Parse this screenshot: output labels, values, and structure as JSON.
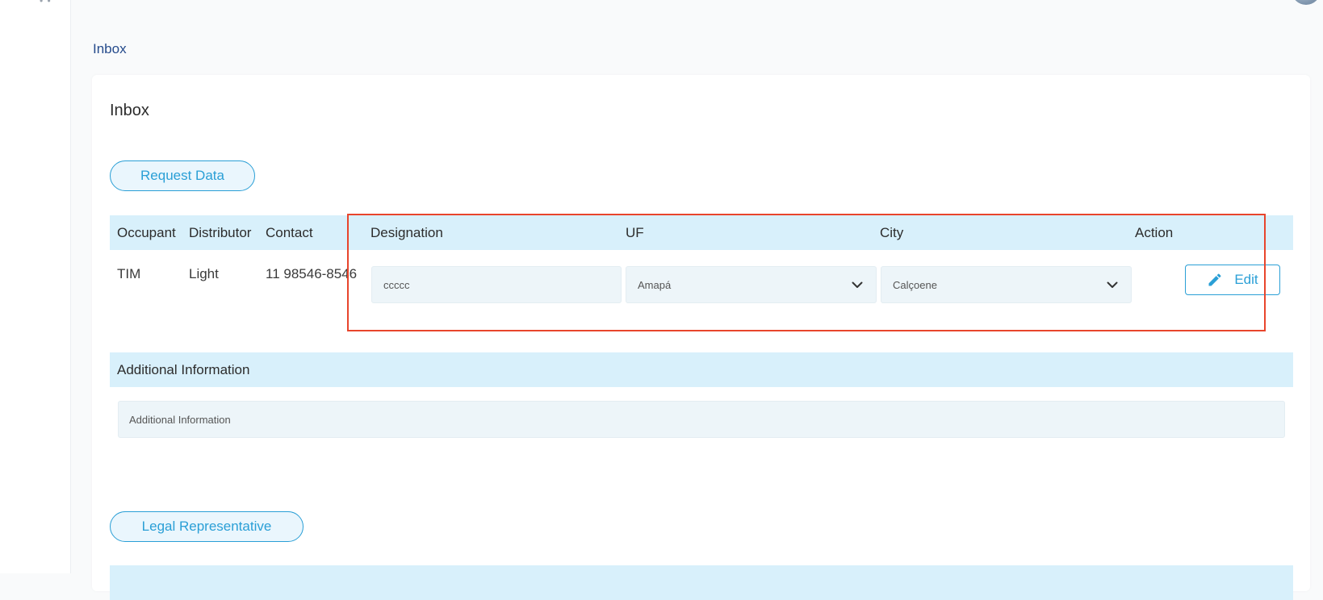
{
  "breadcrumb": "Inbox",
  "card": {
    "title": "Inbox",
    "request_button": "Request Data",
    "legal_button": "Legal Representative"
  },
  "table": {
    "columns": [
      "Occupant",
      "Distributor",
      "Contact",
      "Designation",
      "UF",
      "City",
      "Action"
    ],
    "row": {
      "occupant": "TIM",
      "distributor": "Light",
      "contact": "11 98546-8546",
      "designation": "ccccc",
      "uf": "Amapá",
      "city": "Calçoene",
      "action_label": "Edit"
    }
  },
  "additional": {
    "header": "Additional Information",
    "placeholder": "Additional Information"
  },
  "icons": {
    "edit": "pencil-icon",
    "select": "chevron-down-icon"
  },
  "colors": {
    "accent": "#2a9fd6",
    "header_bg": "#d8f0fb",
    "field_bg": "#edf5f9",
    "highlight": "#e8452c",
    "breadcrumb": "#264b8c"
  }
}
